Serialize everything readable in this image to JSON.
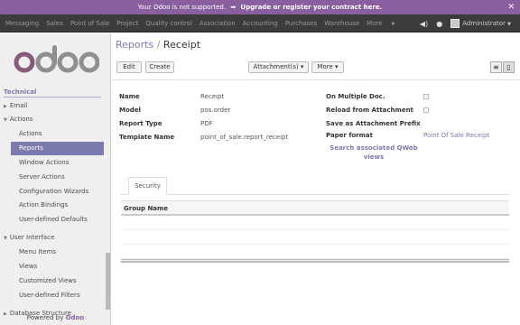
{
  "notice": {
    "text": "Your Odoo is not supported.",
    "arrow": "➡",
    "link": "Upgrade or register your contract here.",
    "close": "✕"
  },
  "topnav": {
    "menu": [
      "Messaging",
      "Sales",
      "Point of Sale",
      "Project",
      "Quality control",
      "Association",
      "Accounting",
      "Purchases",
      "Warehouse"
    ],
    "more": "More",
    "user": "Administrator"
  },
  "sidebar": {
    "logo": "odoo",
    "section": "Technical",
    "items": [
      {
        "label": "Email"
      },
      {
        "label": "Actions"
      },
      {
        "label": "Actions"
      },
      {
        "label": "Reports"
      },
      {
        "label": "Window Actions"
      },
      {
        "label": "Server Actions"
      },
      {
        "label": "Configuration Wizards"
      },
      {
        "label": "Action Bindings"
      },
      {
        "label": "User-defined Defaults"
      },
      {
        "label": "User Interface"
      },
      {
        "label": "Menu Items"
      },
      {
        "label": "Views"
      },
      {
        "label": "Customized Views"
      },
      {
        "label": "User-defined Filters"
      },
      {
        "label": "Database Structure"
      }
    ],
    "powered_prefix": "Powered by",
    "powered_brand": "Odoo"
  },
  "main": {
    "breadcrumb_parent": "Reports",
    "breadcrumb_sep": "/",
    "breadcrumb_current": "Receipt",
    "buttons": {
      "edit": "Edit",
      "create": "Create",
      "attachments": "Attachment(s) ▾",
      "more": "More ▾"
    },
    "fields_left": [
      {
        "label": "Name",
        "value": "Receipt"
      },
      {
        "label": "Model",
        "value": "pos.order"
      },
      {
        "label": "Report Type",
        "value": "PDF"
      },
      {
        "label": "Template Name",
        "value": "point_of_sale.report_receipt"
      }
    ],
    "fields_right": [
      {
        "label": "On Multiple Doc."
      },
      {
        "label": "Reload from Attachment"
      },
      {
        "label": "Save as Attachment Prefix"
      },
      {
        "label": "Paper format",
        "value": "Point Of Sale Receipt"
      }
    ],
    "qweb_link": "Search associated QWeb views",
    "tab": "Security",
    "table_header": "Group Name",
    "table_rows": 3
  },
  "colors": {
    "brand": "#8a5fa0",
    "accent": "#7c7bad",
    "nav": "#3c3c3c"
  }
}
